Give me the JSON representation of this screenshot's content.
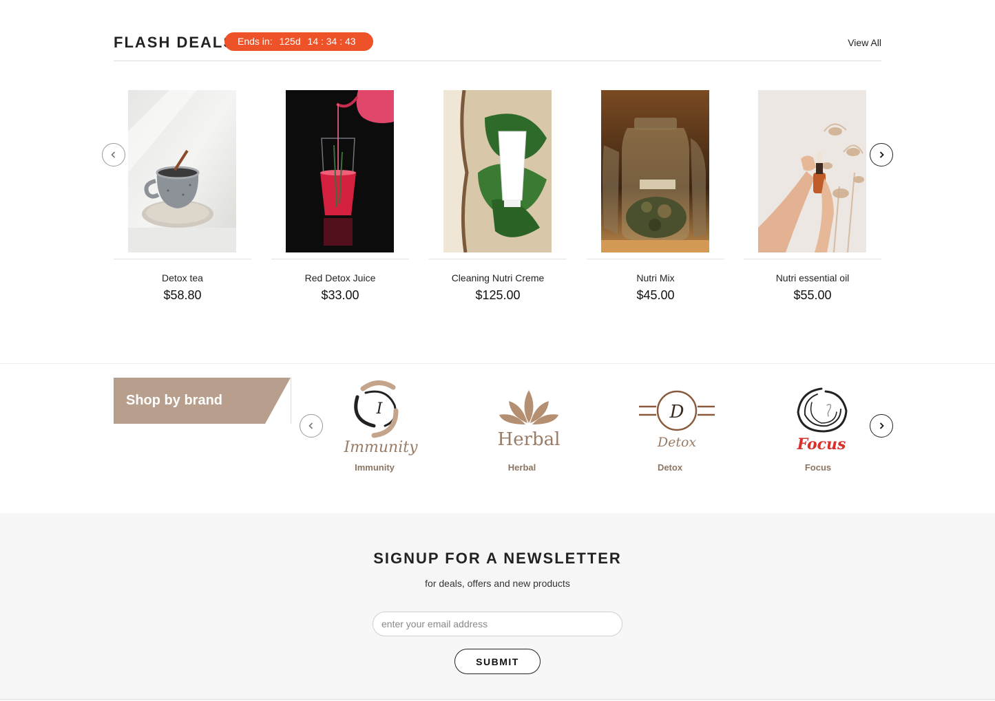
{
  "flash_deals": {
    "title": "FLASH DEALS",
    "countdown_prefix": "Ends in:",
    "countdown_days": "125d",
    "countdown_time": "14 : 34 : 43",
    "view_all": "View All",
    "accent_color": "#ee5228",
    "products": [
      {
        "name": "Detox tea",
        "price": "$58.80",
        "image_icon": "mug-of-tea"
      },
      {
        "name": "Red Detox Juice",
        "price": "$33.00",
        "image_icon": "red-juice-glass"
      },
      {
        "name": "Cleaning Nutri Creme",
        "price": "$125.00",
        "image_icon": "creme-tube-on-leaves"
      },
      {
        "name": "Nutri Mix",
        "price": "$45.00",
        "image_icon": "glass-jars"
      },
      {
        "name": "Nutri essential oil",
        "price": "$55.00",
        "image_icon": "oil-dropper-bottle"
      }
    ]
  },
  "brands": {
    "banner": "Shop by brand",
    "banner_color": "#b89e8c",
    "items": [
      {
        "label": "Immunity",
        "logo_text": "Immunity",
        "logo_initial": "I"
      },
      {
        "label": "Herbal",
        "logo_text": "Herbal"
      },
      {
        "label": "Detox",
        "logo_text": "Detox",
        "logo_initial": "D"
      },
      {
        "label": "Focus",
        "logo_text": "Focus"
      }
    ]
  },
  "newsletter": {
    "title": "SIGNUP FOR A NEWSLETTER",
    "subtitle": "for deals, offers and new products",
    "placeholder": "enter your email address",
    "submit_label": "SUBMIT"
  }
}
